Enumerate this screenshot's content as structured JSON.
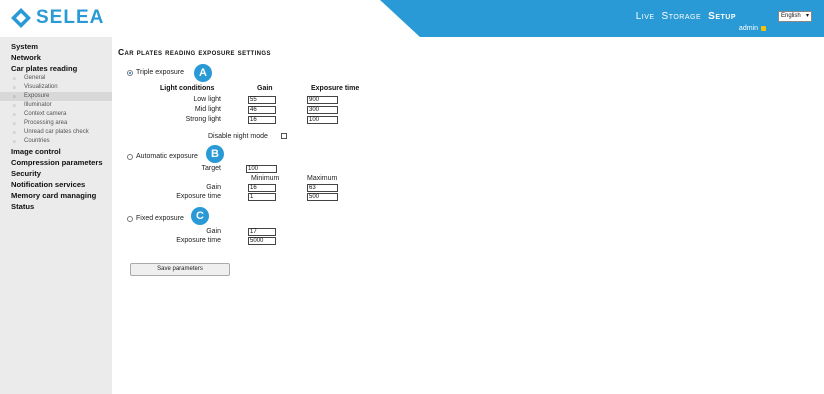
{
  "header": {
    "brand": "SELEA",
    "nav": [
      "Live",
      "Storage",
      "Setup"
    ],
    "active_nav": "Setup",
    "language": "English",
    "user": "admin",
    "accent_color": "#2a9ad6"
  },
  "sidebar": {
    "sections": [
      {
        "label": "System"
      },
      {
        "label": "Network"
      },
      {
        "label": "Car plates reading"
      },
      {
        "label": "Image control"
      },
      {
        "label": "Compression parameters"
      },
      {
        "label": "Security"
      },
      {
        "label": "Notification services"
      },
      {
        "label": "Memory card managing"
      },
      {
        "label": "Status"
      }
    ],
    "sub_items": [
      "General",
      "Visualization",
      "Exposure",
      "Illuminator",
      "Context camera",
      "Processing area",
      "Unread car plates check",
      "Countries"
    ],
    "active_sub": "Exposure"
  },
  "page": {
    "title": "Car plates reading exposure settings",
    "triple": {
      "label": "Triple exposure",
      "badge": "A",
      "selected": true,
      "col_conditions": "Light conditions",
      "col_gain": "Gain",
      "col_exposure": "Exposure time",
      "rows": [
        {
          "label": "Low light",
          "gain": "55",
          "exposure": "900"
        },
        {
          "label": "Mid light",
          "gain": "46",
          "exposure": "300"
        },
        {
          "label": "Strong light",
          "gain": "16",
          "exposure": "100"
        }
      ],
      "night_mode_label": "Disable night mode"
    },
    "automatic": {
      "label": "Automatic exposure",
      "badge": "B",
      "target_label": "Target",
      "target": "100",
      "col_min": "Minimum",
      "col_max": "Maximum",
      "gain_label": "Gain",
      "gain_min": "16",
      "gain_max": "63",
      "exposure_label": "Exposure time",
      "exposure_min": "1",
      "exposure_max": "500"
    },
    "fixed": {
      "label": "Fixed exposure",
      "badge": "C",
      "gain_label": "Gain",
      "gain": "17",
      "exposure_label": "Exposure time",
      "exposure": "5000"
    },
    "save_label": "Save parameters"
  }
}
